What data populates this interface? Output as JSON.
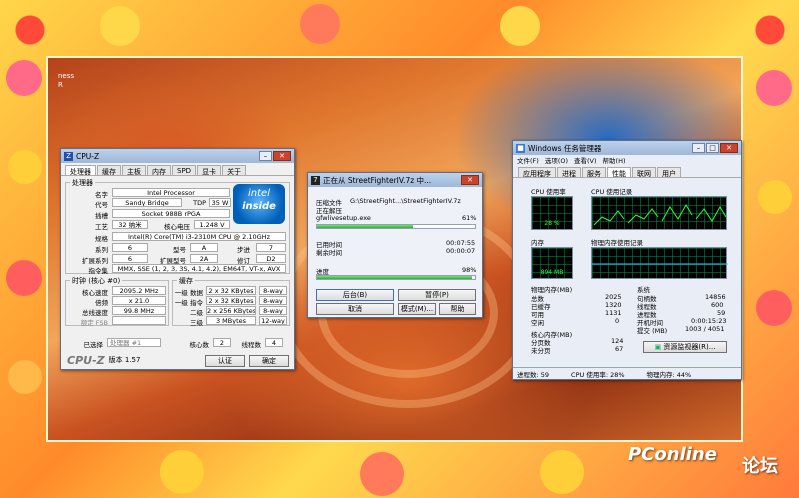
{
  "desktop": {
    "corner_text_1": "ness",
    "corner_text_2": "R"
  },
  "cpuz": {
    "title": "CPU-Z",
    "tabs": [
      "处理器",
      "缓存",
      "主板",
      "内存",
      "SPD",
      "显卡",
      "关于"
    ],
    "processor_group": "处理器",
    "name_label": "名字",
    "name": "Intel Processor",
    "codename_label": "代号",
    "codename": "Sandy Bridge",
    "tdp_label": "TDP",
    "tdp": "35 W",
    "package_label": "插槽",
    "package": "Socket 988B rPGA",
    "tech_label": "工艺",
    "tech": "32 纳米",
    "voltage_label": "核心电压",
    "voltage": "1.248 V",
    "spec_label": "规格",
    "spec": "Intel(R) Core(TM) i3-2310M CPU @ 2.10GHz",
    "family_label": "系列",
    "family": "6",
    "model_label": "型号",
    "model": "A",
    "stepping_label": "步进",
    "stepping": "7",
    "ext_family_label": "扩展系列",
    "ext_family": "6",
    "ext_model_label": "扩展型号",
    "ext_model": "2A",
    "revision_label": "修订",
    "revision": "D2",
    "instr_label": "指令集",
    "instr": "MMX, SSE (1, 2, 3, 3S, 4.1, 4.2), EM64T, VT-x, AVX",
    "clocks_group": "时钟 (核心 #0)",
    "core_speed_label": "核心速度",
    "core_speed": "2095.2 MHz",
    "multiplier_label": "倍频",
    "multiplier": "x 21.0",
    "bus_label": "总线速度",
    "bus": "99.8 MHz",
    "fsb_label": "额定 FSB",
    "fsb": "",
    "cache_group": "缓存",
    "l1d_label": "一级 数据",
    "l1d": "2 x 32 KBytes",
    "l1d_way": "8-way",
    "l1i_label": "一级 指令",
    "l1i": "2 x 32 KBytes",
    "l1i_way": "8-way",
    "l2_label": "二级",
    "l2": "2 x 256 KBytes",
    "l2_way": "8-way",
    "l3_label": "三级",
    "l3": "3 MBytes",
    "l3_way": "12-way",
    "selection_label": "已选择",
    "selection": "处理器 #1",
    "cores_label": "核心数",
    "cores": "2",
    "threads_label": "线程数",
    "threads": "4",
    "logo": "CPU-Z",
    "version": "版本 1.57",
    "validate_button": "认证",
    "ok_button": "确定",
    "intel_line1": "intel",
    "intel_line2": "inside"
  },
  "zip": {
    "title": "正在从 StreetFighterIV.7z 中...",
    "archive_label": "压缩文件",
    "archive_path": "G:\\StreetFight...\\StreetFighterIV.7z",
    "extracting_label": "正在解压",
    "file": "gfwlivesetup.exe",
    "file_percent": "61%",
    "file_progress": 0.61,
    "elapsed_label": "已用时间",
    "elapsed": "00:07:55",
    "remaining_label": "剩余时间",
    "remaining": "00:00:07",
    "progress_label": "进度",
    "progress_percent": "98%",
    "progress": 0.98,
    "background_button": "后台(B)",
    "pause_button": "暂停(P)",
    "cancel_button": "取消",
    "mode_button": "模式(M)...",
    "help_button": "帮助"
  },
  "taskmgr": {
    "title": "Windows 任务管理器",
    "menu": [
      "文件(F)",
      "选项(O)",
      "查看(V)",
      "帮助(H)"
    ],
    "tabs": [
      "应用程序",
      "进程",
      "服务",
      "性能",
      "联网",
      "用户"
    ],
    "cpu_usage_label": "CPU 使用率",
    "cpu_usage": "28 %",
    "cpu_history_label": "CPU 使用记录",
    "memory_label": "内存",
    "memory_usage": "894 MB",
    "memory_history_label": "物理内存使用记录",
    "physical_group": "物理内存(MB)",
    "total_label": "总数",
    "total": "2025",
    "cached_label": "已缓存",
    "cached": "1320",
    "available_label": "可用",
    "available": "1131",
    "free_label": "空闲",
    "free": "0",
    "system_group": "系统",
    "handles_label": "句柄数",
    "handles": "14856",
    "threads_label": "线程数",
    "threads": "600",
    "processes_label": "进程数",
    "processes": "59",
    "uptime_label": "开机时间",
    "uptime": "0:00:15:23",
    "commit_label": "提交 (MB)",
    "commit": "1003 / 4051",
    "kernel_group": "核心内存(MB)",
    "paged_label": "分页数",
    "paged": "124",
    "nonpaged_label": "未分页",
    "nonpaged": "67",
    "resource_monitor_button": "资源监视器(R)...",
    "status_processes": "进程数: 59",
    "status_cpu": "CPU 使用率: 28%",
    "status_memory": "物理内存: 44%"
  },
  "watermark": {
    "brand": "PConline",
    "suffix": "论坛"
  }
}
